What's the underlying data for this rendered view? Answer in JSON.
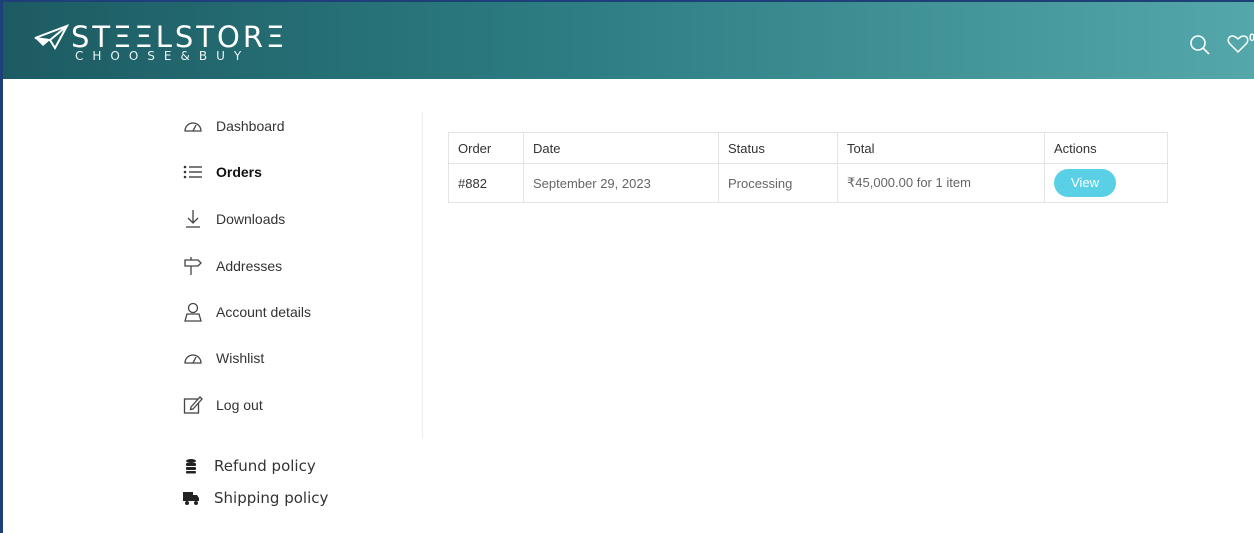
{
  "header": {
    "brand": "STΞΞLSTORΞ",
    "tagline": "CHOOSE&BUY",
    "wishlist_count": "0"
  },
  "nav": {
    "items": [
      {
        "label": "Dashboard",
        "icon": "gauge-icon"
      },
      {
        "label": "Orders",
        "icon": "list-icon",
        "active": true
      },
      {
        "label": "Downloads",
        "icon": "download-icon"
      },
      {
        "label": "Addresses",
        "icon": "signpost-icon"
      },
      {
        "label": "Account details",
        "icon": "user-icon"
      },
      {
        "label": "Wishlist",
        "icon": "gauge-icon"
      },
      {
        "label": "Log out",
        "icon": "edit-icon"
      }
    ]
  },
  "policies": [
    {
      "label": "Refund policy",
      "icon": "coins-icon"
    },
    {
      "label": "Shipping policy",
      "icon": "truck-icon"
    }
  ],
  "orders_table": {
    "headers": [
      "Order",
      "Date",
      "Status",
      "Total",
      "Actions"
    ],
    "rows": [
      {
        "order": "#882",
        "date": "September 29, 2023",
        "status": "Processing",
        "total": "₹45,000.00 for 1 item",
        "action": "View"
      }
    ]
  },
  "colors": {
    "header_start": "#1d5b62",
    "header_end": "#54a7aa",
    "button": "#5ad0e6"
  }
}
